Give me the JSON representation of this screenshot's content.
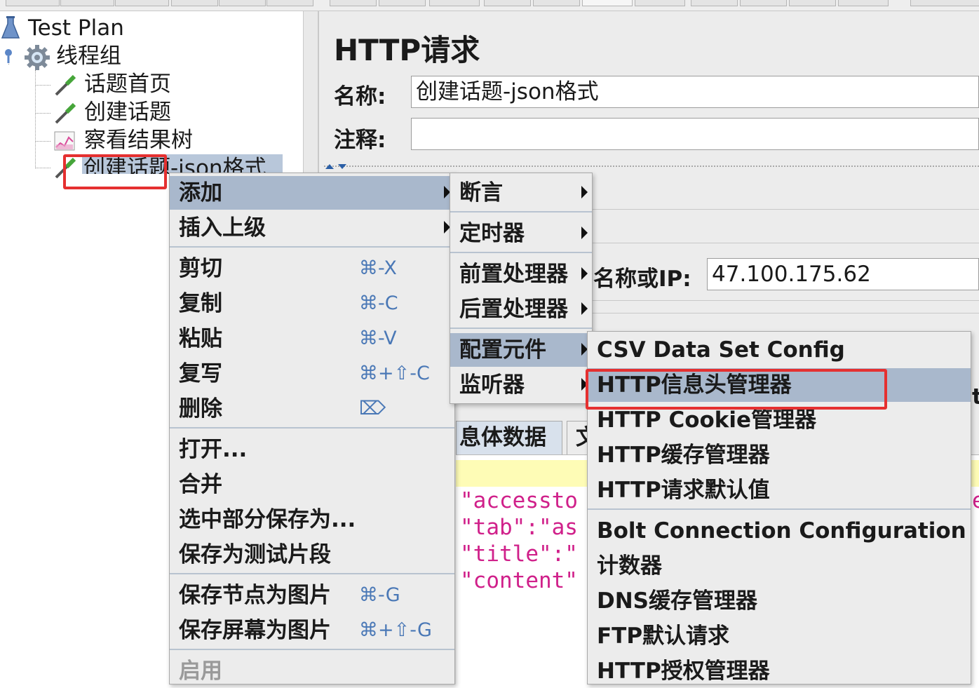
{
  "tree": {
    "items": [
      {
        "label": "Test Plan",
        "icon": "flask-icon"
      },
      {
        "label": "线程组",
        "icon": "gear-icon"
      },
      {
        "label": "话题首页",
        "icon": "pipette-icon"
      },
      {
        "label": "创建话题",
        "icon": "pipette-icon"
      },
      {
        "label": "察看结果树",
        "icon": "chart-icon"
      },
      {
        "label": "创建话题-json格式",
        "icon": "pipette-icon"
      }
    ]
  },
  "panel": {
    "title": "HTTP请求",
    "name_label": "名称:",
    "name_value": "创建话题-json格式",
    "comment_label": "注释:",
    "comment_value": "",
    "ip_label": "名称或IP:",
    "ip_value": "47.100.175.62",
    "body_tab": "息体数据",
    "second_tab_partial": "文",
    "right_edge_partial_1": "ti",
    "right_edge_partial_2": "e",
    "json_lines": [
      "\"accessto",
      "\"tab\":\"as",
      "\"title\":\"",
      "\"content\""
    ]
  },
  "context_menu": {
    "items": [
      {
        "label": "添加",
        "submenu": true,
        "selected": true
      },
      {
        "label": "插入上级",
        "submenu": true
      },
      {
        "label": "剪切",
        "shortcut": "⌘-X"
      },
      {
        "label": "复制",
        "shortcut": "⌘-C"
      },
      {
        "label": "粘贴",
        "shortcut": "⌘-V"
      },
      {
        "label": "复写",
        "shortcut": "⌘+⇧-C"
      },
      {
        "label": "删除",
        "shortcut": "⌦"
      },
      {
        "label": "打开..."
      },
      {
        "label": "合并"
      },
      {
        "label": "选中部分保存为..."
      },
      {
        "label": "保存为测试片段"
      },
      {
        "label": "保存节点为图片",
        "shortcut": "⌘-G"
      },
      {
        "label": "保存屏幕为图片",
        "shortcut": "⌘+⇧-G"
      },
      {
        "label": "启用",
        "disabled": true
      }
    ]
  },
  "add_submenu": {
    "items": [
      {
        "label": "断言"
      },
      {
        "label": "定时器"
      },
      {
        "label": "前置处理器"
      },
      {
        "label": "后置处理器"
      },
      {
        "label": "配置元件",
        "selected": true
      },
      {
        "label": "监听器"
      }
    ]
  },
  "config_submenu": {
    "items": [
      {
        "label": "CSV Data Set Config"
      },
      {
        "label": "HTTP信息头管理器",
        "selected": true
      },
      {
        "label": "HTTP Cookie管理器"
      },
      {
        "label": "HTTP缓存管理器"
      },
      {
        "label": "HTTP请求默认值"
      },
      {
        "label": "Bolt Connection Configuration"
      },
      {
        "label": "计数器"
      },
      {
        "label": "DNS缓存管理器"
      },
      {
        "label": "FTP默认请求"
      },
      {
        "label": "HTTP授权管理器"
      }
    ]
  },
  "colors": {
    "selection": "#a9b8cc",
    "highlight_box": "#e53030",
    "json_text": "#d0208a",
    "shortcut": "#4a78b6",
    "yellow_band": "#fefcb6"
  }
}
